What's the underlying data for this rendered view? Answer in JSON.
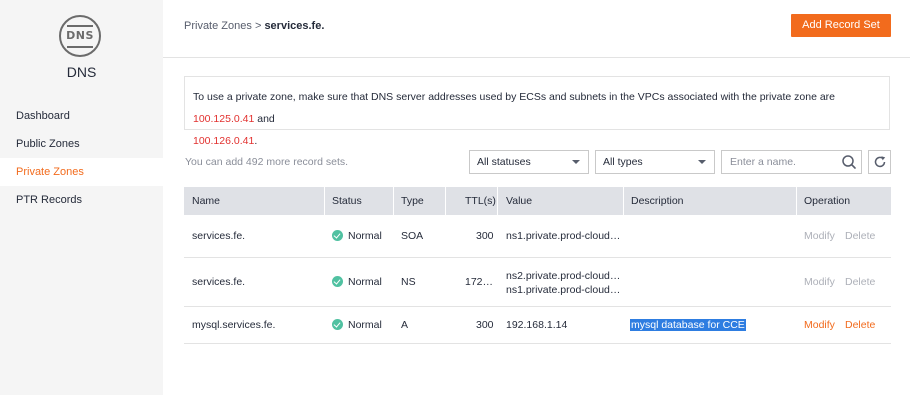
{
  "sidebar": {
    "logo_text": "DNS",
    "title": "DNS",
    "items": [
      {
        "label": "Dashboard"
      },
      {
        "label": "Public Zones"
      },
      {
        "label": "Private Zones"
      },
      {
        "label": "PTR Records"
      }
    ],
    "active_item": "Private Zones"
  },
  "header": {
    "breadcrumb_parent": "Private Zones",
    "breadcrumb_separator": ">",
    "breadcrumb_current": "services.fe.",
    "add_button": "Add Record Set"
  },
  "notice": {
    "text_before": "To use a private zone, make sure that DNS server addresses used by ECSs and subnets in the VPCs associated with the private zone are ",
    "ip1": "100.125.0.41",
    "text_middle": " and",
    "ip2": "100.126.0.41",
    "text_after": "."
  },
  "toolbar": {
    "quota_text": "You can add 492 more record sets.",
    "status_filter": "All statuses",
    "type_filter": "All types",
    "search_placeholder": "Enter a name."
  },
  "table": {
    "columns": [
      "Name",
      "Status",
      "Type",
      "TTL(s)",
      "Value",
      "Description",
      "Operation"
    ],
    "rows": [
      {
        "name": "services.fe.",
        "status": "Normal",
        "type": "SOA",
        "ttl": "300",
        "value1": "ns1.private.prod-cloud…",
        "value2": "",
        "description": "",
        "modify": "Modify",
        "delete": "Delete"
      },
      {
        "name": "services.fe.",
        "status": "Normal",
        "type": "NS",
        "ttl": "172…",
        "value1": "ns2.private.prod-cloud…",
        "value2": "ns1.private.prod-cloud…",
        "description": "",
        "modify": "Modify",
        "delete": "Delete"
      },
      {
        "name": "mysql.services.fe.",
        "status": "Normal",
        "type": "A",
        "ttl": "300",
        "value1": "192.168.1.14",
        "value2": "",
        "description": "mysql database for CCE",
        "modify": "Modify",
        "delete": "Delete"
      }
    ]
  },
  "colors": {
    "accent": "#f26b1d",
    "ip_red": "#e2312f",
    "status_green": "#50c1a1",
    "selection_blue": "#2e7de1"
  }
}
